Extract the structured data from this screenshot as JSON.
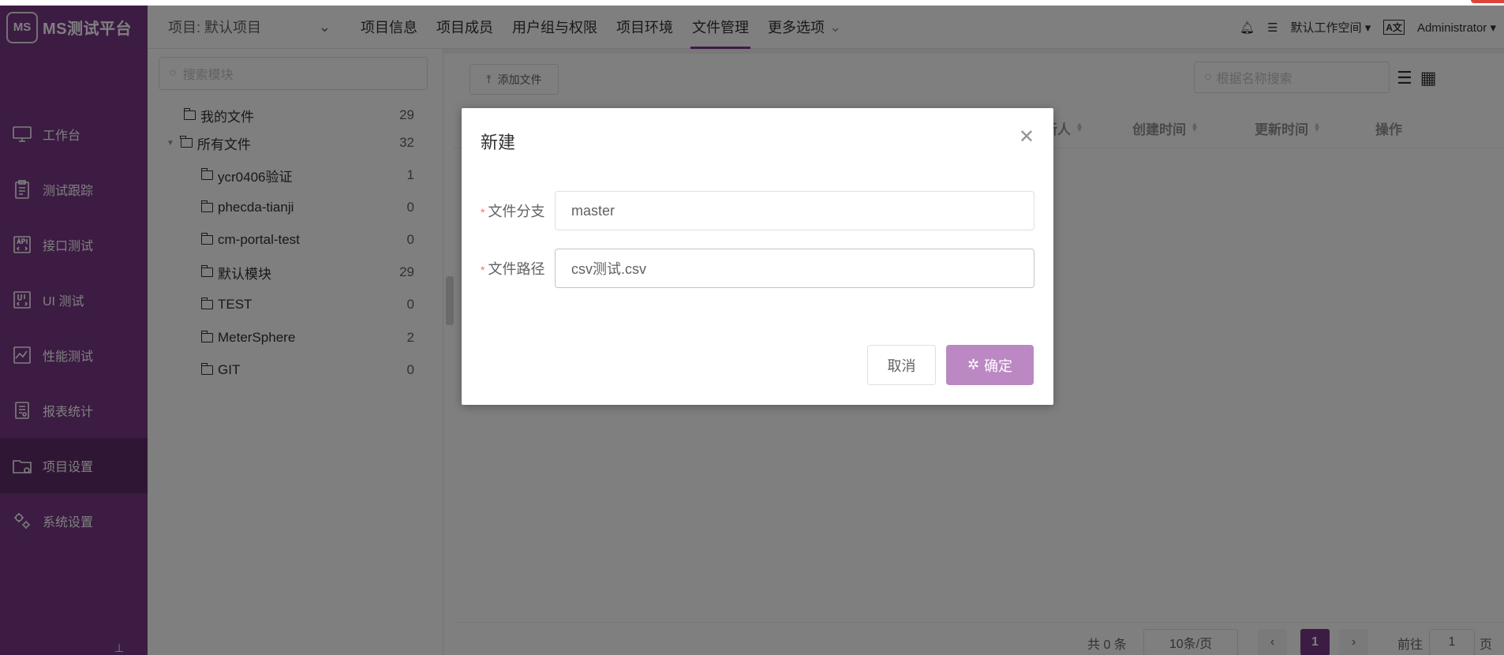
{
  "app": {
    "logo_badge": "MS",
    "logo_text": "MS测试平台"
  },
  "sidebar": {
    "items": [
      {
        "label": "工作台",
        "icon": "monitor-icon"
      },
      {
        "label": "测试跟踪",
        "icon": "clipboard-icon"
      },
      {
        "label": "接口测试",
        "icon": "api-icon"
      },
      {
        "label": "UI 测试",
        "icon": "ui-icon"
      },
      {
        "label": "性能测试",
        "icon": "chart-icon"
      },
      {
        "label": "报表统计",
        "icon": "report-icon"
      },
      {
        "label": "项目设置",
        "icon": "folder-settings-icon",
        "active": true
      },
      {
        "label": "系统设置",
        "icon": "gears-icon"
      }
    ]
  },
  "topbar": {
    "project": "项目: 默认项目",
    "nav": [
      "项目信息",
      "项目成员",
      "用户组与权限",
      "项目环境",
      "文件管理",
      "更多选项"
    ],
    "active_nav": "文件管理",
    "workspace": "默认工作空间",
    "user": "Administrator"
  },
  "tree": {
    "search_placeholder": "搜索模块",
    "my_files": {
      "label": "我的文件",
      "count": "29"
    },
    "all_files": {
      "label": "所有文件",
      "count": "32"
    },
    "children": [
      {
        "label": "ycr0406验证",
        "count": "1"
      },
      {
        "label": "phecda-tianji",
        "count": "0"
      },
      {
        "label": "cm-portal-test",
        "count": "0"
      },
      {
        "label": "默认模块",
        "count": "29"
      },
      {
        "label": "TEST",
        "count": "0"
      },
      {
        "label": "MeterSphere",
        "count": "2"
      },
      {
        "label": "GIT",
        "count": "0"
      }
    ]
  },
  "main": {
    "add_file": "添加文件",
    "search_placeholder": "根据名称搜索",
    "columns": [
      "新人",
      "创建时间",
      "更新时间",
      "操作"
    ],
    "pager": {
      "total": "共 0 条",
      "page_size": "10条/页",
      "current": "1",
      "goto_label": "前往",
      "goto_value": "1",
      "page_suffix": "页"
    }
  },
  "dialog": {
    "title": "新建",
    "fields": [
      {
        "label": "文件分支",
        "value": "master"
      },
      {
        "label": "文件路径",
        "value": "csv测试.csv"
      }
    ],
    "cancel": "取消",
    "confirm": "确定"
  },
  "colors": {
    "brand": "#783887",
    "brand_active": "#5e2c6a",
    "confirm_loading": "#bb88c3"
  }
}
